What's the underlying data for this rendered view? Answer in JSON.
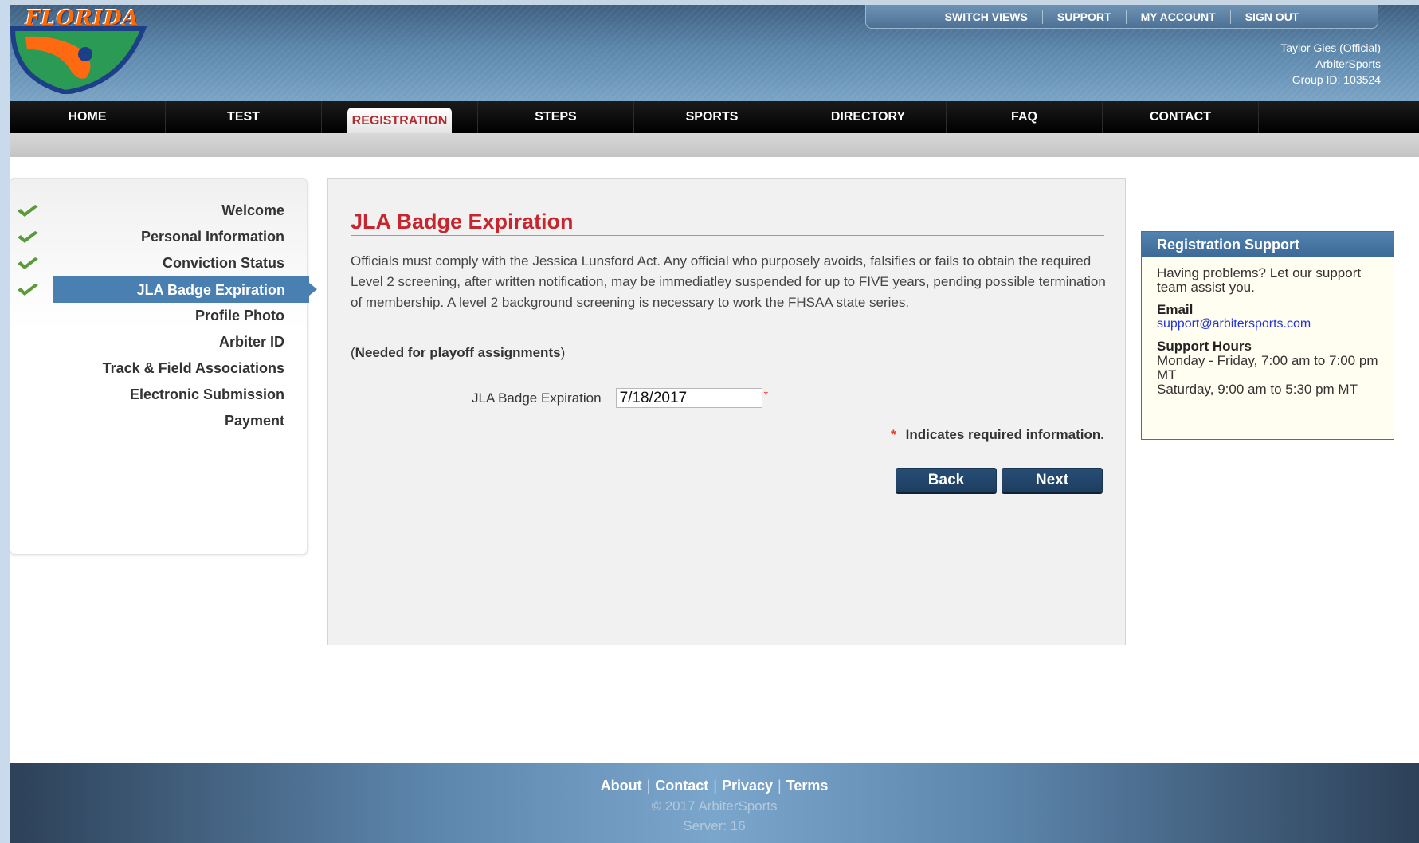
{
  "header": {
    "logo_text": "FLORIDA",
    "util_nav": [
      "SWITCH VIEWS",
      "SUPPORT",
      "MY ACCOUNT",
      "SIGN OUT"
    ],
    "user_name": "Taylor Gies (Official)",
    "org": "ArbiterSports",
    "group_id": "Group ID: 103524"
  },
  "main_nav": {
    "tabs": [
      {
        "label": "HOME",
        "active": false
      },
      {
        "label": "TEST",
        "active": false
      },
      {
        "label": "REGISTRATION",
        "active": true
      },
      {
        "label": "STEPS",
        "active": false
      },
      {
        "label": "SPORTS",
        "active": false
      },
      {
        "label": "DIRECTORY",
        "active": false
      },
      {
        "label": "FAQ",
        "active": false
      },
      {
        "label": "CONTACT",
        "active": false
      }
    ]
  },
  "sidebar": {
    "steps": [
      {
        "label": "Welcome",
        "completed": true,
        "active": false
      },
      {
        "label": "Personal Information",
        "completed": true,
        "active": false
      },
      {
        "label": "Conviction Status",
        "completed": true,
        "active": false
      },
      {
        "label": "JLA Badge Expiration",
        "completed": true,
        "active": true
      },
      {
        "label": "Profile Photo",
        "completed": false,
        "active": false
      },
      {
        "label": "Arbiter ID",
        "completed": false,
        "active": false
      },
      {
        "label": "Track & Field Associations",
        "completed": false,
        "active": false
      },
      {
        "label": "Electronic Submission",
        "completed": false,
        "active": false
      },
      {
        "label": "Payment",
        "completed": false,
        "active": false
      }
    ]
  },
  "main": {
    "title": "JLA Badge Expiration",
    "intro": "Officials must comply with the Jessica Lunsford Act. Any official who purposely avoids, falsifies or fails to obtain the required Level 2 screening, after written notification, may be immediatley suspended for up to FIVE years, pending possible termination of membership. A level 2 background screening is necessary to work the FHSAA state series.",
    "needed_open": "(",
    "needed_note": "Needed for playoff assignments",
    "needed_close": ")",
    "field_label": "JLA Badge Expiration",
    "field_value": "7/18/2017",
    "required_star": "*",
    "required_note": "Indicates required information.",
    "back_label": "Back",
    "next_label": "Next"
  },
  "support": {
    "title": "Registration Support",
    "intro": "Having problems? Let our support team assist you.",
    "email_heading": "Email",
    "email": "support@arbitersports.com",
    "hours_heading": "Support Hours",
    "hours": "Monday - Friday, 7:00 am to 7:00 pm MT",
    "hours_sat": "Saturday, 9:00 am to 5:30 pm MT"
  },
  "footer": {
    "links": [
      "About",
      "Contact",
      "Privacy",
      "Terms"
    ],
    "separator": "|",
    "copyright": "© 2017 ArbiterSports",
    "server": "Server: 16"
  },
  "colors": {
    "accent_red": "#c7262f",
    "nav_black": "#000000",
    "active_step_blue": "#4a7fb1",
    "button_navy": "#1e3e60",
    "check_green": "#5a9a3a"
  }
}
